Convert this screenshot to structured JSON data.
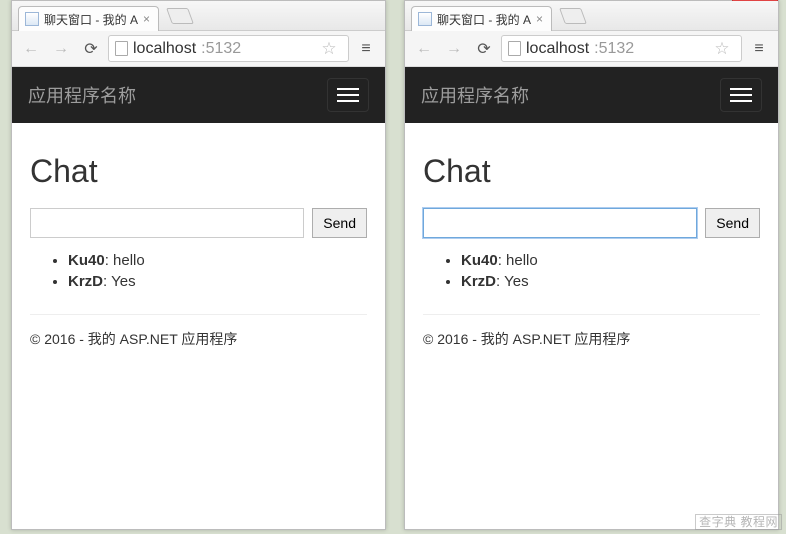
{
  "windows": [
    {
      "tab_title": "聊天窗口 - 我的 A",
      "url_host": "localhost",
      "url_port": ":5132",
      "brand": "应用程序名称",
      "page_heading": "Chat",
      "send_label": "Send",
      "input_value": "",
      "input_focused": false,
      "messages": [
        {
          "user": "Ku40",
          "text": "hello"
        },
        {
          "user": "KrzD",
          "text": "Yes"
        }
      ],
      "footer": "© 2016 - 我的 ASP.NET 应用程序"
    },
    {
      "tab_title": "聊天窗口 - 我的 A",
      "url_host": "localhost",
      "url_port": ":5132",
      "brand": "应用程序名称",
      "page_heading": "Chat",
      "send_label": "Send",
      "input_value": "",
      "input_focused": true,
      "messages": [
        {
          "user": "Ku40",
          "text": "hello"
        },
        {
          "user": "KrzD",
          "text": "Yes"
        }
      ],
      "footer": "© 2016 - 我的 ASP.NET 应用程序"
    }
  ],
  "close_label": "×",
  "watermark": "查字典 教程网"
}
